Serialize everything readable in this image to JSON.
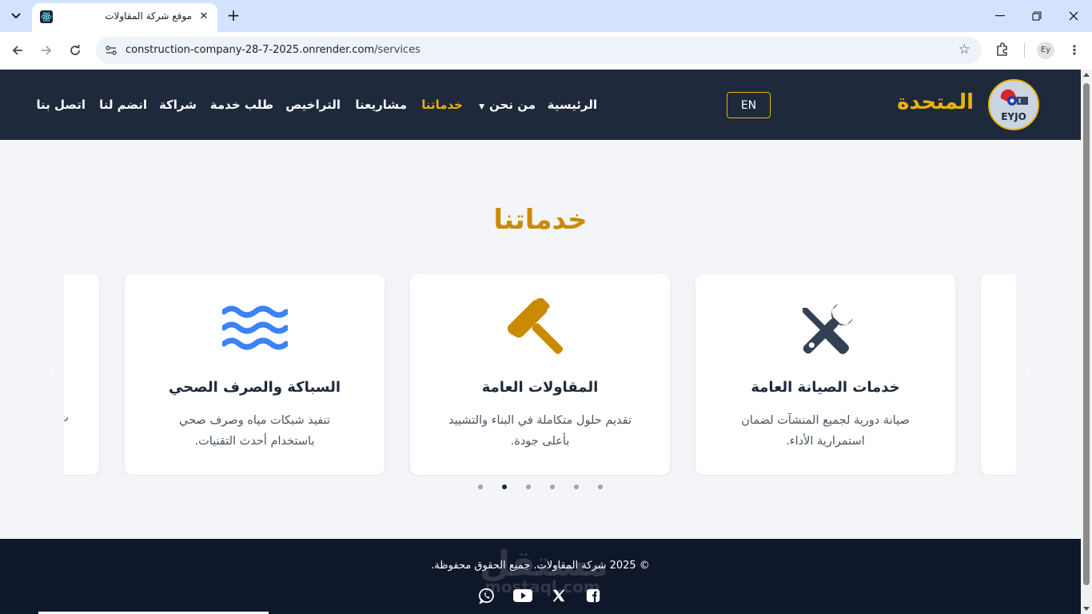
{
  "browser": {
    "tab_title": "موقع شركة المقاولات",
    "url_host": "construction-company-28-7-2025.onrender.com",
    "url_path": "/services",
    "profile_initials": "Ey"
  },
  "header": {
    "brand": "المتحدة",
    "logo_text": "EYJO",
    "lang_button": "EN",
    "nav": [
      {
        "label": "الرئيسية",
        "active": false
      },
      {
        "label": "من نحن",
        "active": false
      },
      {
        "label": "خدماتنا",
        "active": true
      },
      {
        "label": "مشاريعنا",
        "active": false
      },
      {
        "label": "التراخيص",
        "active": false
      },
      {
        "label": "طلب خدمة",
        "active": false
      },
      {
        "label": "شراكة",
        "active": false
      },
      {
        "label": "انضم لنا",
        "active": false
      },
      {
        "label": "اتصل بنا",
        "active": false
      }
    ]
  },
  "colors": {
    "accent": "#eab308",
    "title": "#ca8a04",
    "header_bg": "#1e293b",
    "footer_bg": "#0f172a",
    "plumbing_icon": "#3b82f6",
    "contracting_icon": "#ca8a04",
    "maintenance_icon": "#334155"
  },
  "services": {
    "title": "خدماتنا",
    "cards": [
      {
        "icon": "water-waves-icon",
        "title": "السباكة والصرف الصحي",
        "desc": "تنفيذ شبكات مياه وصرف صحي باستخدام أحدث التقنيات."
      },
      {
        "icon": "hammer-icon",
        "title": "المقاولات العامة",
        "desc": "تقديم حلول متكاملة في البناء والتشييد بأعلى جودة."
      },
      {
        "icon": "wrench-screwdriver-icon",
        "title": "خدمات الصيانة العامة",
        "desc": "صيانة دورية لجميع المنشآت لضمان استمرارية الأداء."
      }
    ],
    "partial_left_text": "ت",
    "dots_count": 6,
    "active_dot": 2
  },
  "footer": {
    "copyright": "© 2025 شركة المقاولات. جميع الحقوق محفوظة.",
    "watermark": "مستقل",
    "watermark_sub": "mostaql.com",
    "social": [
      "whatsapp-icon",
      "youtube-icon",
      "x-icon",
      "facebook-icon"
    ]
  }
}
